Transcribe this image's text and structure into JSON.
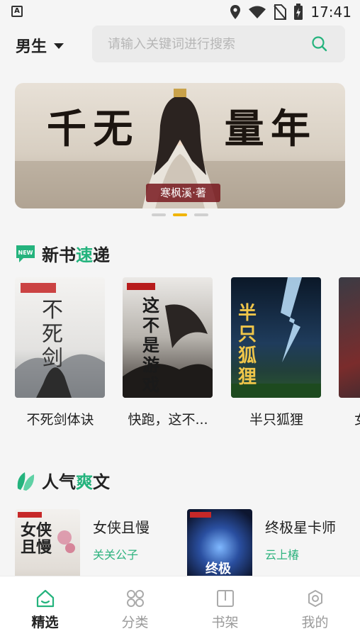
{
  "status": {
    "time": "17:41"
  },
  "header": {
    "gender": "男生",
    "search_placeholder": "请输入关键词进行搜索"
  },
  "banner": {
    "title_chars": [
      "千",
      "无",
      "量",
      "年"
    ],
    "author_tag": "寒枫溪·著"
  },
  "sections": {
    "new_books": {
      "title_prefix": "新书",
      "title_accent": "速",
      "title_suffix": "递",
      "badge": "NEW"
    },
    "popular": {
      "title_prefix": "人气",
      "title_accent": "爽",
      "title_suffix": "文"
    }
  },
  "new_books": [
    {
      "title": "不死剑体诀",
      "cover_text": "不死剑"
    },
    {
      "title": "快跑，这不...",
      "cover_text": "这不是游戏"
    },
    {
      "title": "半只狐狸",
      "cover_text": "半只狐狸"
    },
    {
      "title": "女"
    }
  ],
  "popular_books": [
    {
      "title": "女侠且慢",
      "author": "关关公子",
      "cover_text": "女侠且慢"
    },
    {
      "title": "终极星卡师",
      "author": "云上椿",
      "cover_text": "终极"
    }
  ],
  "tabs": [
    {
      "label": "精选",
      "icon": "home-icon",
      "active": true
    },
    {
      "label": "分类",
      "icon": "category-icon",
      "active": false
    },
    {
      "label": "书架",
      "icon": "bookshelf-icon",
      "active": false
    },
    {
      "label": "我的",
      "icon": "profile-icon",
      "active": false
    }
  ],
  "colors": {
    "accent": "#24b37d",
    "banner_dot": "#f0b400"
  }
}
